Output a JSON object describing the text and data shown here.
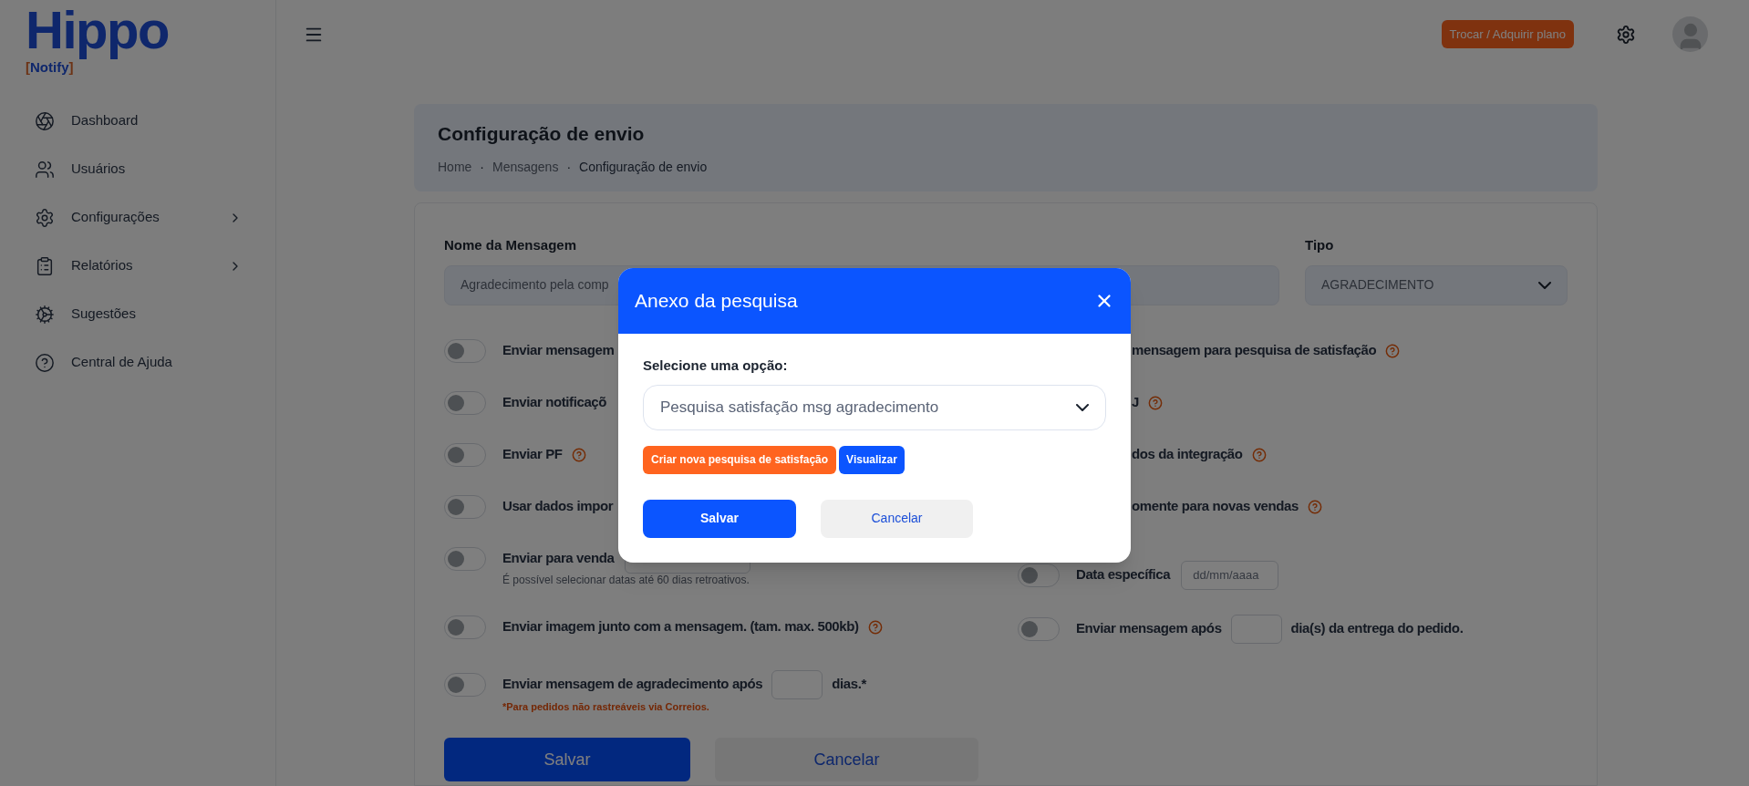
{
  "logo": {
    "name": "Hippo",
    "bracket_open": "[",
    "sub": "Notify",
    "bracket_close": "]"
  },
  "sidebar": {
    "items": [
      {
        "label": "Dashboard",
        "expandable": false
      },
      {
        "label": "Usuários",
        "expandable": false
      },
      {
        "label": "Configurações",
        "expandable": true
      },
      {
        "label": "Relatórios",
        "expandable": true
      },
      {
        "label": "Sugestões",
        "expandable": false
      },
      {
        "label": "Central de Ajuda",
        "expandable": false
      }
    ]
  },
  "header": {
    "plan_button": "Trocar / Adquirir plano"
  },
  "page_header": {
    "title": "Configuração de envio",
    "separator": "·",
    "breadcrumbs": [
      "Home",
      "Mensagens",
      "Configuração de envio"
    ]
  },
  "form": {
    "name_label": "Nome da Mensagem",
    "name_value": "Agradecimento pela comp",
    "type_label": "Tipo",
    "type_value": "AGRADECIMENTO",
    "left_rows": [
      {
        "kind": "plain",
        "label": "Enviar mensagem",
        "on": false
      },
      {
        "kind": "plain",
        "label": "Enviar notificaçõ",
        "on": false
      },
      {
        "kind": "plain",
        "label": "Enviar PF",
        "on": false,
        "help": true
      },
      {
        "kind": "plain",
        "label": "Usar dados impor",
        "on": false
      },
      {
        "kind": "date",
        "label": "Enviar para venda",
        "on": false,
        "hint": "É possível selecionar datas até 60 dias retroativos."
      },
      {
        "kind": "plain",
        "label": "Enviar imagem junto com a mensagem. (tam. max. 500kb)",
        "on": false,
        "help": true
      },
      {
        "kind": "days",
        "label": "Enviar mensagem de agradecimento após",
        "suffix": "dias.*",
        "on": false,
        "note": "*Para pedidos não rastreáveis via Correios."
      }
    ],
    "right_rows": [
      {
        "kind": "cut",
        "label": "mensagem para pesquisa de satisfação",
        "help": true
      },
      {
        "kind": "cut",
        "label": "J",
        "help": true
      },
      {
        "kind": "cut",
        "label": "dos da integração",
        "help": true
      },
      {
        "kind": "cut",
        "label": "omente para novas vendas",
        "help": true
      },
      {
        "kind": "date",
        "label": "Data específica",
        "on": false,
        "placeholder": "dd/mm/aaaa"
      },
      {
        "kind": "days",
        "label": "Enviar mensagem após",
        "suffix": "dia(s) da entrega do pedido.",
        "on": false
      }
    ],
    "buttons": {
      "save": "Salvar",
      "cancel": "Cancelar"
    }
  },
  "modal": {
    "title": "Anexo da pesquisa",
    "select_label": "Selecione uma opção:",
    "select_value": "Pesquisa satisfação msg agradecimento",
    "create_button": "Criar nova pesquisa de satisfação",
    "view_button": "Visualizar",
    "save": "Salvar",
    "cancel": "Cancelar"
  }
}
